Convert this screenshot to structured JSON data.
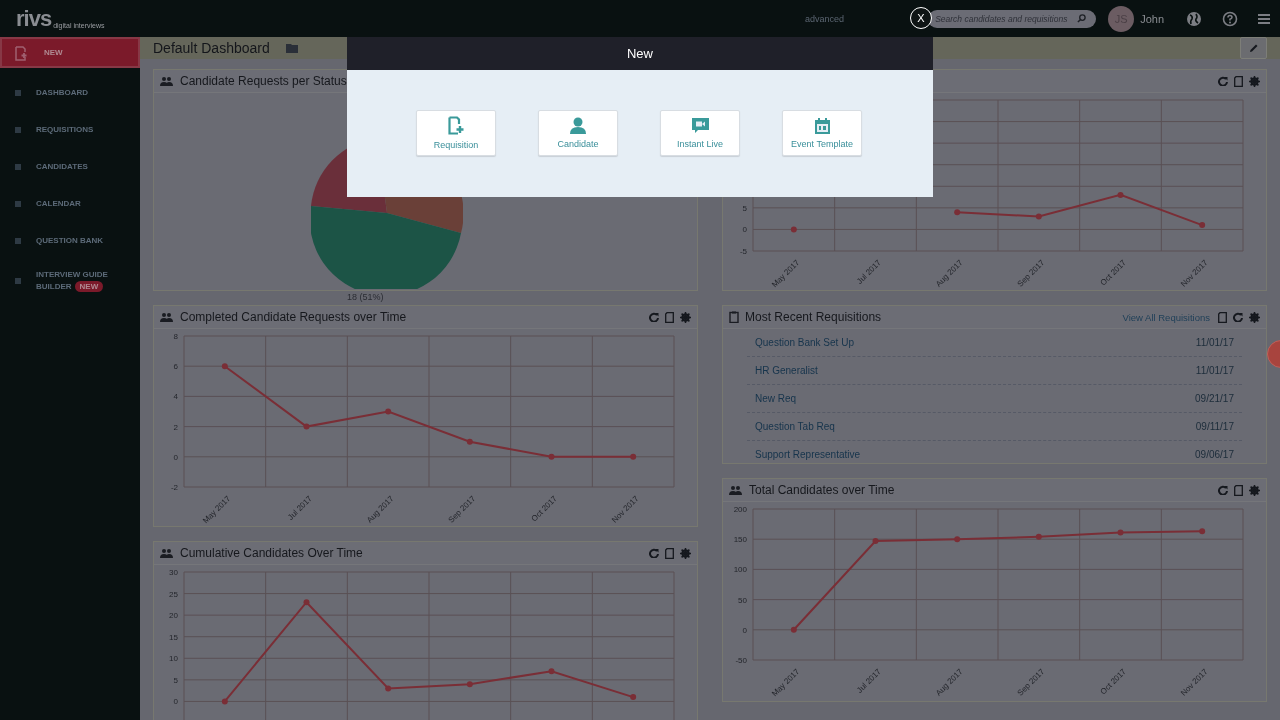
{
  "top_bar": {
    "logo": "rivs",
    "logo_tagline": "digital interviews",
    "advanced_link": "advanced",
    "search": {
      "placeholder": "Search candidates and requisitions"
    },
    "avatar_initials": "JS",
    "user_name": "John"
  },
  "sidebar": {
    "items": [
      {
        "label": "NEW",
        "selected": true
      },
      {
        "label": "DASHBOARD",
        "selected": false
      },
      {
        "label": "REQUISITIONS",
        "selected": false
      },
      {
        "label": "CANDIDATES",
        "selected": false
      },
      {
        "label": "CALENDAR",
        "selected": false
      },
      {
        "label": "QUESTION BANK",
        "selected": false
      },
      {
        "label": "INTERVIEW GUIDE BUILDER",
        "selected": false,
        "badge": "NEW"
      }
    ]
  },
  "dashboard": {
    "title": "Default Dashboard"
  },
  "left_column": [
    {
      "kind": "pie",
      "title": "Candidate Requests per Status",
      "slice_label": "18 (51%)"
    },
    {
      "kind": "line",
      "title": "Completed Candidate Requests over Time",
      "chart_data": {
        "type": "line",
        "categories": [
          "May 2017",
          "Jul 2017",
          "Aug 2017",
          "Sep 2017",
          "Oct 2017",
          "Nov 2017"
        ],
        "grid": true,
        "series": [
          {
            "color": "#7a2e36",
            "marker": true,
            "values": [
              6,
              2,
              3,
              1,
              0,
              0
            ]
          }
        ],
        "ylim": [
          -2,
          8
        ],
        "yticks": [
          -2,
          0,
          2,
          4,
          6,
          8
        ]
      }
    },
    {
      "kind": "line",
      "title": "Cumulative Candidates Over Time",
      "chart_data": {
        "type": "line",
        "grid": true,
        "series": [
          {
            "color": "#7a2e36",
            "marker": true,
            "values": [
              0,
              23,
              3,
              4,
              7,
              1
            ]
          }
        ],
        "ylim": [
          -5,
          30
        ],
        "yticks": [
          0,
          5,
          10,
          15,
          20,
          25,
          30
        ]
      }
    }
  ],
  "right_column": [
    {
      "kind": "line",
      "chart_data": {
        "type": "line",
        "categories": [
          "May 2017",
          "Jul 2017",
          "Aug 2017",
          "Sep 2017",
          "Oct 2017",
          "Nov 2017"
        ],
        "grid": true,
        "series": [
          {
            "color": "#7a2e36",
            "marker": true,
            "values": [
              0,
              null,
              4,
              3,
              8,
              1
            ]
          }
        ],
        "ylim": [
          -5,
          30
        ],
        "yticks": [
          -5,
          0,
          5
        ]
      }
    },
    {
      "kind": "list",
      "title": "Most Recent Requisitions",
      "link": "View All Requisitions",
      "rows": [
        {
          "name": "Question Bank Set Up",
          "date": "11/01/17"
        },
        {
          "name": "HR Generalist",
          "date": "11/01/17"
        },
        {
          "name": "New Req",
          "date": "09/21/17"
        },
        {
          "name": "Question Tab Req",
          "date": "09/11/17"
        },
        {
          "name": "Support Representative",
          "date": "09/06/17"
        }
      ]
    },
    {
      "kind": "line",
      "title": "Total Candidates over Time",
      "chart_data": {
        "type": "line",
        "categories": [
          "May 2017",
          "Jul 2017",
          "Aug 2017",
          "Sep 2017",
          "Oct 2017",
          "Nov 2017"
        ],
        "grid": true,
        "series": [
          {
            "color": "#7a2e36",
            "marker": true,
            "values": [
              0,
              147,
              150,
              154,
              161,
              163
            ]
          }
        ],
        "ylim": [
          -50,
          200
        ],
        "yticks": [
          -50,
          0,
          50,
          100,
          150,
          200
        ]
      }
    }
  ],
  "modal": {
    "title": "New",
    "close": "X",
    "options": [
      {
        "label": "Requisition"
      },
      {
        "label": "Candidate"
      },
      {
        "label": "Instant Live"
      },
      {
        "label": "Event Template"
      }
    ]
  }
}
